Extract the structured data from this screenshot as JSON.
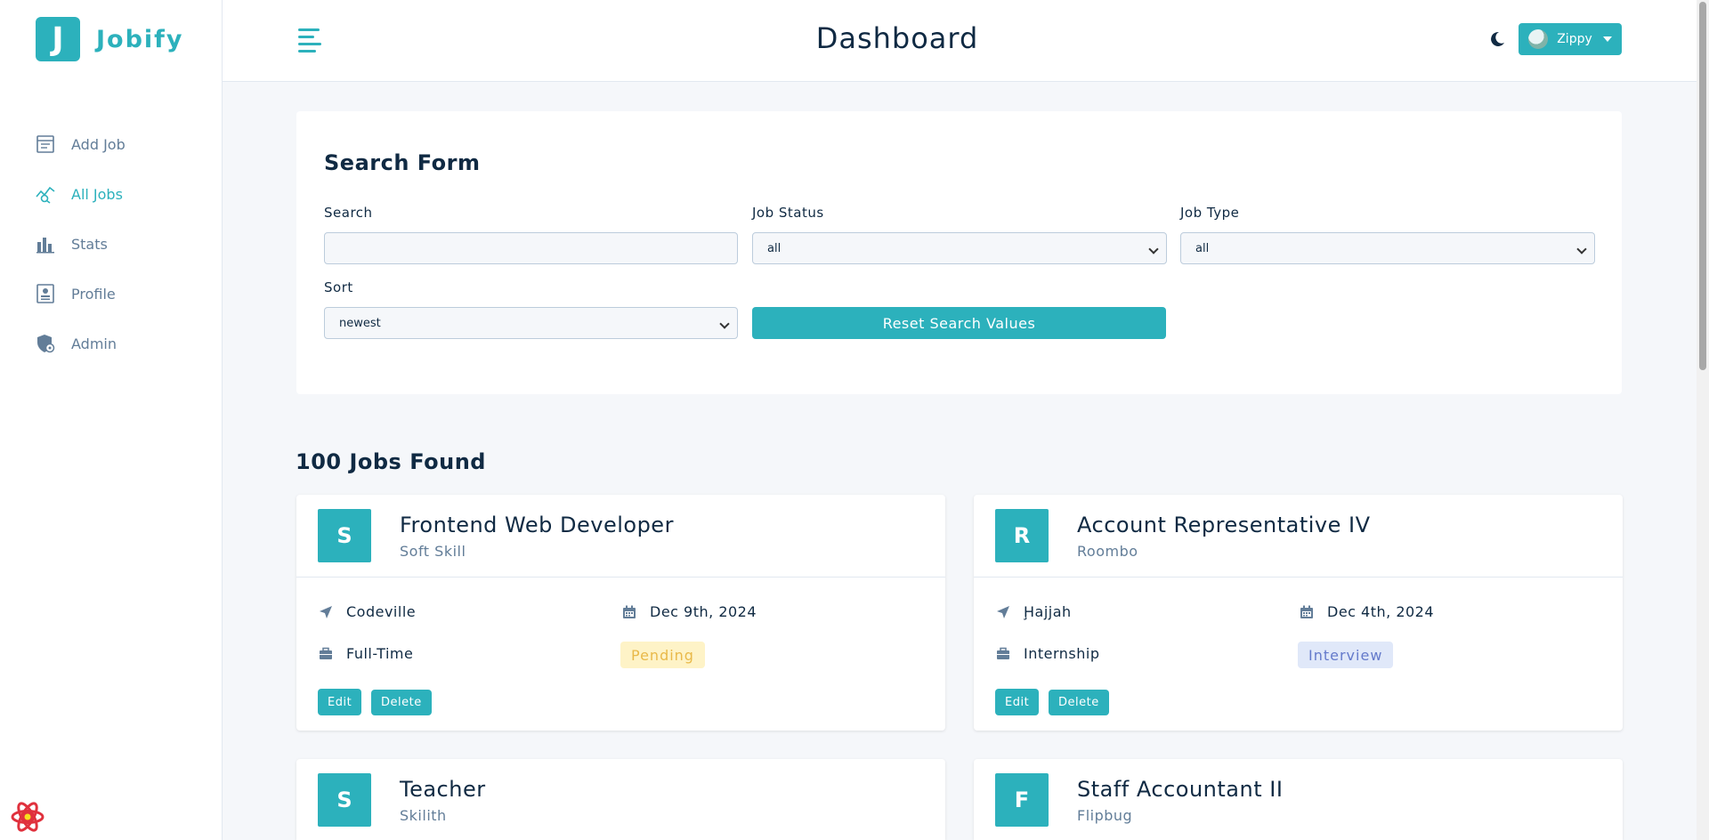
{
  "brand": {
    "mark": "J",
    "name": "Jobify"
  },
  "header": {
    "title": "Dashboard",
    "user": "Zippy"
  },
  "sidebar": {
    "items": [
      {
        "label": "Add Job",
        "icon": "add-job-icon"
      },
      {
        "label": "All Jobs",
        "icon": "all-jobs-icon",
        "active": true
      },
      {
        "label": "Stats",
        "icon": "stats-icon"
      },
      {
        "label": "Profile",
        "icon": "profile-icon"
      },
      {
        "label": "Admin",
        "icon": "admin-icon"
      }
    ]
  },
  "search_form": {
    "title": "Search Form",
    "search_label": "Search",
    "search_value": "",
    "status_label": "Job Status",
    "status_value": "all",
    "type_label": "Job Type",
    "type_value": "all",
    "sort_label": "Sort",
    "sort_value": "newest",
    "reset_label": "Reset Search Values"
  },
  "jobs_found": "100 Jobs Found",
  "jobs": [
    {
      "mark": "S",
      "position": "Frontend Web Developer",
      "company": "Soft Skill",
      "location": "Codeville",
      "date": "Dec 9th, 2024",
      "type": "Full-Time",
      "status": "Pending",
      "edit": "Edit",
      "delete": "Delete"
    },
    {
      "mark": "R",
      "position": "Account Representative IV",
      "company": "Roombo",
      "location": "Ḩajjah",
      "date": "Dec 4th, 2024",
      "type": "Internship",
      "status": "Interview",
      "edit": "Edit",
      "delete": "Delete"
    },
    {
      "mark": "S",
      "position": "Teacher",
      "company": "Skilith"
    },
    {
      "mark": "F",
      "position": "Staff Accountant II",
      "company": "Flipbug"
    }
  ],
  "colors": {
    "primary": "#2cb1bc",
    "pending_bg": "#fef3c7",
    "pending_text": "#e9b949",
    "interview_bg": "#e0e8f9",
    "interview_text": "#647acb"
  }
}
